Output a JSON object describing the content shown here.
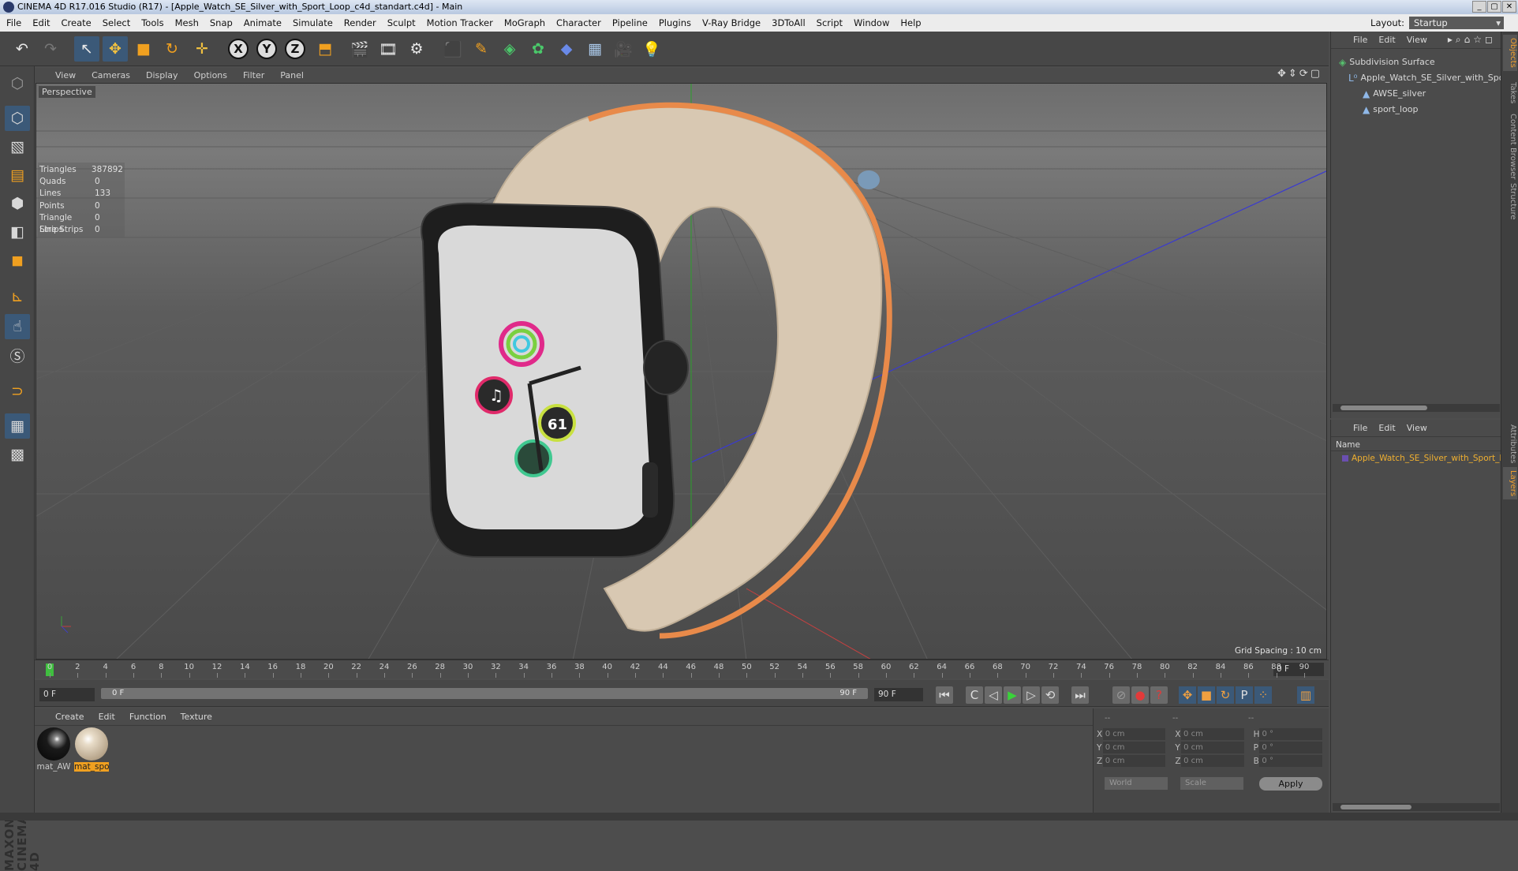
{
  "window": {
    "title": "CINEMA 4D R17.016 Studio (R17) - [Apple_Watch_SE_Silver_with_Sport_Loop_c4d_standart.c4d] - Main",
    "buttons": [
      "_",
      "▢",
      "✕"
    ]
  },
  "menu": {
    "items": [
      "File",
      "Edit",
      "Create",
      "Select",
      "Tools",
      "Mesh",
      "Snap",
      "Animate",
      "Simulate",
      "Render",
      "Sculpt",
      "Motion Tracker",
      "MoGraph",
      "Character",
      "Pipeline",
      "Plugins",
      "V-Ray Bridge",
      "3DToAll",
      "Script",
      "Window",
      "Help"
    ]
  },
  "layout": {
    "label": "Layout:",
    "value": "Startup"
  },
  "toolbar": {
    "undo": "↶",
    "redo": "↷",
    "select": "↖",
    "move": "✥",
    "scale": "■",
    "rotate": "↻",
    "live": "✛",
    "x_lock": "X",
    "y_lock": "Y",
    "z_lock": "Z",
    "coord": "⬒",
    "render_view": "🎬",
    "render_picture": "🎞",
    "render_settings": "⚙",
    "cube": "⬛",
    "pen": "✎",
    "subdiv": "◈",
    "mograph": "✿",
    "deformer": "◆",
    "floor": "▦",
    "camera": "🎥",
    "light": "💡"
  },
  "lefttools": {
    "model": "⬡",
    "texture": "▧",
    "workplane": "▤",
    "point": "⬢",
    "edge": "◧",
    "polygon": "◼",
    "axis": "⊾",
    "tweak": "☝",
    "snap": "Ⓢ",
    "magnet": "⊃",
    "grid_a": "▦",
    "grid_b": "▩"
  },
  "maxon": "MAXON CINEMA 4D",
  "viewport": {
    "menu": [
      "View",
      "Cameras",
      "Display",
      "Options",
      "Filter",
      "Panel"
    ],
    "nav_icons": "✥⇕⟳▢",
    "label": "Perspective",
    "stats": [
      {
        "k": "Triangles",
        "v": "387892"
      },
      {
        "k": "Quads",
        "v": "0"
      },
      {
        "k": "Lines",
        "v": "133"
      },
      {
        "k": "Points",
        "v": "0"
      },
      {
        "k": "Triangle Strips",
        "v": "0"
      },
      {
        "k": "Line Strips",
        "v": "0"
      }
    ],
    "grid_spacing": "Grid Spacing : 10 cm",
    "watch_complication": "61"
  },
  "timeline": {
    "ticks": [
      "0",
      "2",
      "4",
      "6",
      "8",
      "10",
      "12",
      "14",
      "16",
      "18",
      "20",
      "22",
      "24",
      "26",
      "28",
      "30",
      "32",
      "34",
      "36",
      "38",
      "40",
      "42",
      "44",
      "46",
      "48",
      "50",
      "52",
      "54",
      "56",
      "58",
      "60",
      "62",
      "64",
      "66",
      "68",
      "70",
      "72",
      "74",
      "76",
      "78",
      "80",
      "82",
      "84",
      "86",
      "88",
      "90"
    ],
    "frame_end": "0 F"
  },
  "controls": {
    "current": "0 F",
    "slider_start": "0 F",
    "slider_end": "90 F",
    "max": "90 F",
    "first": "⏮",
    "prev_key": "C",
    "prev": "◁",
    "play": "▶",
    "next": "▷",
    "loop": "⟲",
    "last": "⏭",
    "rec1": "⊘",
    "rec2": "●",
    "rec3": "?",
    "k1": "✥",
    "k2": "■",
    "k3": "↻",
    "k4": "P",
    "k5": "⁘",
    "film": "▥"
  },
  "materials": {
    "menu": [
      "Create",
      "Edit",
      "Function",
      "Texture"
    ],
    "items": [
      {
        "label": "mat_AW",
        "color": "#1a1a1a"
      },
      {
        "label": "mat_spo",
        "color": "#d9cbb5"
      }
    ]
  },
  "coords": {
    "header": [
      "--",
      "--",
      "--"
    ],
    "rows": [
      {
        "a1": "X",
        "v1": "0 cm",
        "a2": "X",
        "v2": "0 cm",
        "a3": "H",
        "v3": "0 °"
      },
      {
        "a1": "Y",
        "v1": "0 cm",
        "a2": "Y",
        "v2": "0 cm",
        "a3": "P",
        "v3": "0 °"
      },
      {
        "a1": "Z",
        "v1": "0 cm",
        "a2": "Z",
        "v2": "0 cm",
        "a3": "B",
        "v3": "0 °"
      }
    ],
    "world": "World",
    "scale": "Scale",
    "apply": "Apply"
  },
  "objects": {
    "menu": [
      "File",
      "Edit",
      "View"
    ],
    "icons": "▸⌕⌂☆◻",
    "tree": [
      {
        "label": "Subdivision Surface",
        "indent": 0
      },
      {
        "label": "Apple_Watch_SE_Silver_with_Sport_Loop",
        "indent": 1
      },
      {
        "label": "AWSE_silver",
        "indent": 2
      },
      {
        "label": "sport_loop",
        "indent": 2
      }
    ]
  },
  "layers": {
    "menu": [
      "File",
      "Edit",
      "View"
    ],
    "col_name": "Name",
    "item": "Apple_Watch_SE_Silver_with_Sport_Loop"
  },
  "right_tabs": {
    "top": [
      "Objects",
      "Takes",
      "Content Browser",
      "Structure"
    ],
    "bottom": [
      "Attributes",
      "Layers"
    ]
  }
}
